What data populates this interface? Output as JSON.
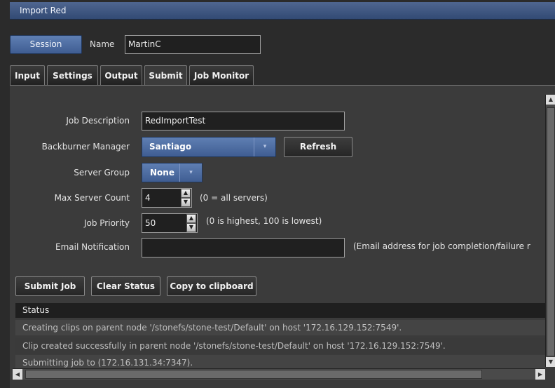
{
  "window": {
    "title": "Import Red"
  },
  "session": {
    "button_label": "Session",
    "name_label": "Name",
    "name_value": "MartinC"
  },
  "tabs": [
    {
      "label": "Input",
      "active": false
    },
    {
      "label": "Settings",
      "active": false
    },
    {
      "label": "Output",
      "active": false
    },
    {
      "label": "Submit",
      "active": true
    },
    {
      "label": "Job Monitor",
      "active": false
    }
  ],
  "form": {
    "job_description": {
      "label": "Job Description",
      "value": "RedImportTest"
    },
    "backburner_manager": {
      "label": "Backburner Manager",
      "value": "Santiago",
      "refresh_label": "Refresh"
    },
    "server_group": {
      "label": "Server Group",
      "value": "None"
    },
    "max_server_count": {
      "label": "Max Server Count",
      "value": "4",
      "hint": "(0 = all servers)"
    },
    "job_priority": {
      "label": "Job Priority",
      "value": "50",
      "hint": "(0 is highest, 100 is lowest)"
    },
    "email_notification": {
      "label": "Email Notification",
      "value": "",
      "hint": "(Email address for job completion/failure r"
    }
  },
  "actions": {
    "submit_job": "Submit Job",
    "clear_status": "Clear Status",
    "copy_to_clipboard": "Copy to clipboard"
  },
  "status": {
    "header": "Status",
    "rows": [
      "Creating clips on parent node '/stonefs/stone-test/Default' on host '172.16.129.152:7549'.",
      "Clip created successfully in parent node '/stonefs/stone-test/Default' on host '172.16.129.152:7549'.",
      "Submitting job to (172.16.131.34:7347)."
    ]
  },
  "icons": {
    "combo_arrow": "chevron-down-icon",
    "spin_up": "triangle-up-icon",
    "spin_down": "triangle-down-icon",
    "scroll_up": "triangle-up-icon",
    "scroll_down": "triangle-down-icon",
    "scroll_left": "triangle-left-icon",
    "scroll_right": "triangle-right-icon"
  },
  "colors": {
    "accent": "#4a6aa0",
    "background": "#3b3b3b",
    "status_header": "#1f1f1f"
  }
}
